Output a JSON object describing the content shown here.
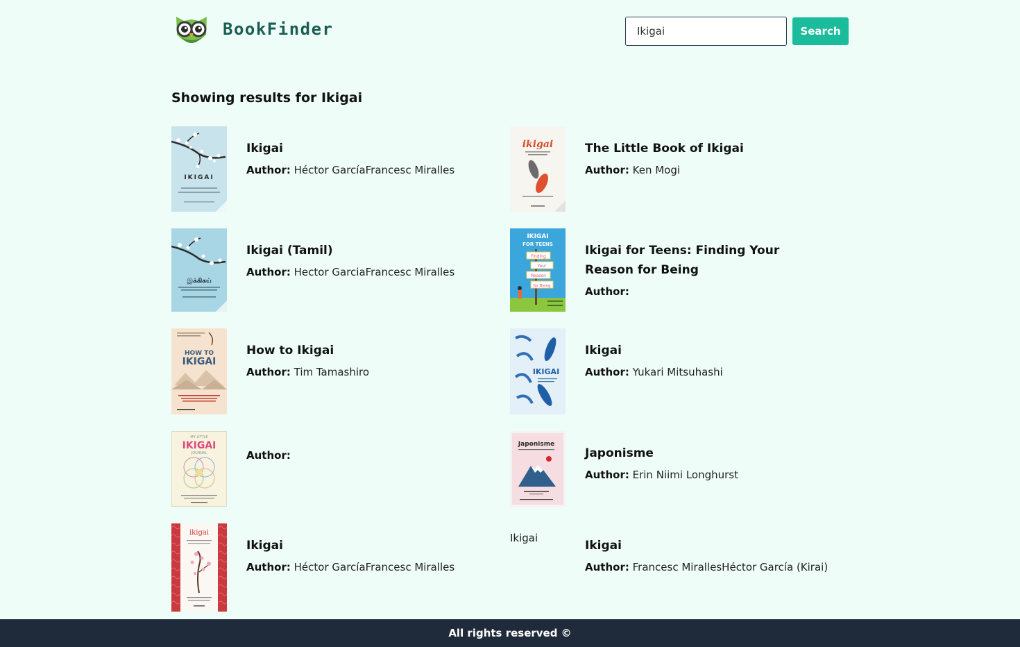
{
  "header": {
    "brand": "BookFinder",
    "search_value": "Ikigai",
    "search_button": "Search"
  },
  "results": {
    "heading": "Showing results for Ikigai",
    "author_label": "Author:",
    "books": [
      {
        "title": "Ikigai",
        "author": "Héctor GarcíaFrancesc Miralles",
        "cover": "ikigai-blossom-cover",
        "alt": ""
      },
      {
        "title": "The Little Book of Ikigai",
        "author": "Ken Mogi",
        "cover": "little-book-ikigai-cover",
        "alt": ""
      },
      {
        "title": "Ikigai (Tamil)",
        "author": "Hector GarciaFrancesc Miralles",
        "cover": "ikigai-tamil-cover",
        "alt": ""
      },
      {
        "title": "Ikigai for Teens: Finding Your Reason for Being",
        "author": "",
        "cover": "ikigai-teens-cover",
        "alt": ""
      },
      {
        "title": "How to Ikigai",
        "author": "Tim Tamashiro",
        "cover": "how-to-ikigai-cover",
        "alt": ""
      },
      {
        "title": "Ikigai",
        "author": "Yukari Mitsuhashi",
        "cover": "ikigai-fish-cover",
        "alt": ""
      },
      {
        "title": "",
        "author": "",
        "cover": "my-little-ikigai-journal-cover",
        "alt": ""
      },
      {
        "title": "Japonisme",
        "author": "Erin Niimi Longhurst",
        "cover": "japonisme-cover",
        "alt": ""
      },
      {
        "title": "Ikigai",
        "author": "Héctor GarcíaFrancesc Miralles",
        "cover": "ikigai-red-cover",
        "alt": ""
      },
      {
        "title": "Ikigai",
        "author": "Francesc MirallesHéctor García (Kirai)",
        "cover": "",
        "alt": "Ikigai"
      }
    ]
  },
  "cover_text": {
    "ikigai_blossom": "IKIGAI",
    "little_book": "ikigai",
    "tamil": "இக்கிகய்",
    "teens_top": "IKIGAI",
    "teens_mid": "FOR TEENS",
    "teens_sign1": "Finding",
    "teens_sign2": "Your",
    "teens_sign3": "Reason",
    "teens_sign4": "for Being",
    "how_to_top": "HOW TO",
    "how_to_main": "IKIGAI",
    "fish_main": "IKIGAI",
    "journal_top": "MY LITTLE",
    "journal_main": "IKIGAI",
    "journal_sub": "JOURNAL",
    "japonisme": "Japonisme",
    "red_title": "ikigai"
  },
  "footer": {
    "text": "All rights reserved ©"
  },
  "colors": {
    "background": "#effdf9",
    "accent": "#1bbc9b",
    "brand_text": "#1a5d52",
    "footer_bg": "#1f2a3a"
  }
}
